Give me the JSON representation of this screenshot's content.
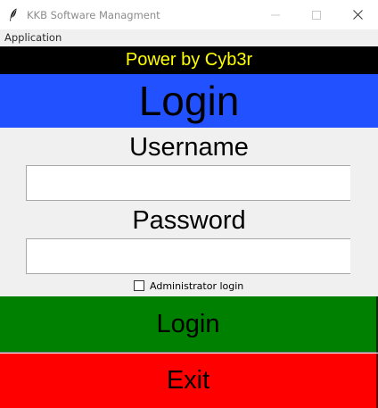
{
  "window": {
    "title": "KKB Software Managment",
    "icon": "feather-icon"
  },
  "menubar": {
    "items": [
      "Application"
    ]
  },
  "banner": {
    "text": "Power by Cyb3r",
    "background": "#000000",
    "color": "#ffff00"
  },
  "header": {
    "title": "Login",
    "background": "#2251ff"
  },
  "form": {
    "username_label": "Username",
    "username_value": "",
    "password_label": "Password",
    "password_value": "",
    "admin_checkbox_label": "Administrator login",
    "admin_checked": false
  },
  "buttons": {
    "login_label": "Login",
    "login_color": "#008000",
    "exit_label": "Exit",
    "exit_color": "#ff0000"
  }
}
